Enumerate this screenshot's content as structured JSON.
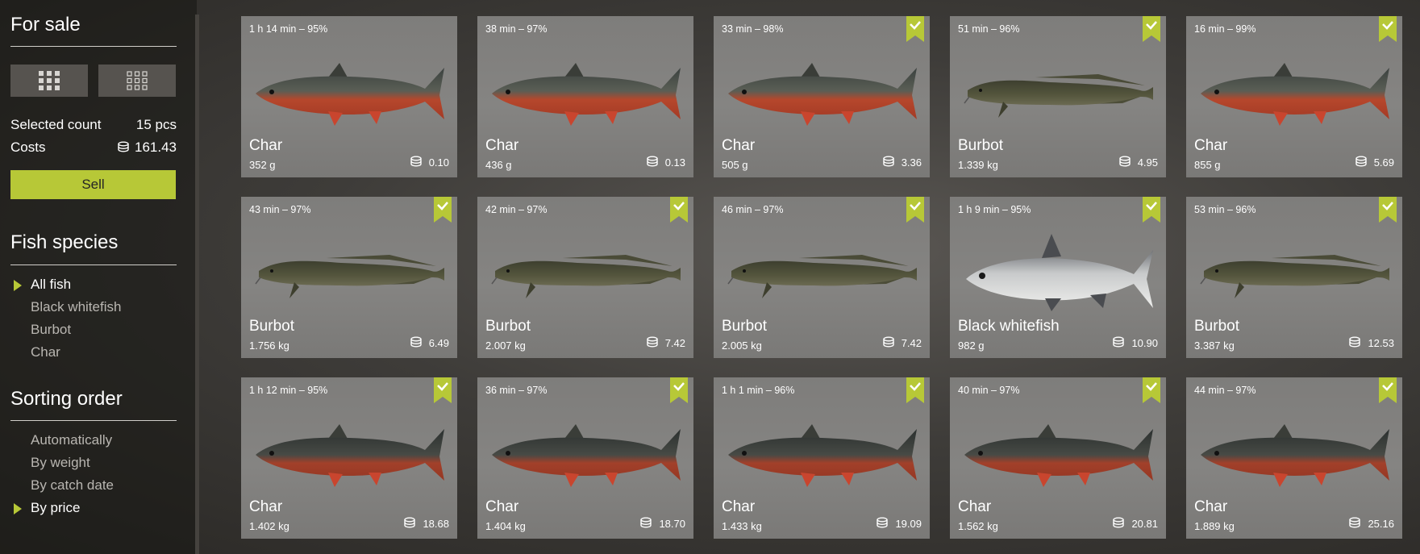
{
  "sidebar": {
    "for_sale_title": "For sale",
    "selected_label": "Selected count",
    "selected_value": "15 pcs",
    "costs_label": "Costs",
    "costs_value": "161.43",
    "sell_label": "Sell",
    "species_title": "Fish species",
    "species": [
      "All fish",
      "Black whitefish",
      "Burbot",
      "Char"
    ],
    "species_active": "All fish",
    "sorting_title": "Sorting order",
    "sorting": [
      "Automatically",
      "By weight",
      "By catch date",
      "By price"
    ],
    "sorting_active": "By price"
  },
  "icons": {
    "view_large": "grid-large-icon",
    "view_small": "grid-small-icon",
    "coin": "coin-stack-icon",
    "selected": "check-bookmark-icon",
    "active_marker": "triangle-right-icon"
  },
  "colors": {
    "accent": "#b7c837",
    "card": "#807f7d"
  },
  "cards": [
    {
      "time": "1 h 14 min – 95%",
      "name": "Char",
      "weight": "352 g",
      "price": "0.10",
      "selected": false,
      "fish": "char-red"
    },
    {
      "time": "38 min – 97%",
      "name": "Char",
      "weight": "436 g",
      "price": "0.13",
      "selected": false,
      "fish": "char-red"
    },
    {
      "time": "33 min – 98%",
      "name": "Char",
      "weight": "505 g",
      "price": "3.36",
      "selected": true,
      "fish": "char-red"
    },
    {
      "time": "51 min – 96%",
      "name": "Burbot",
      "weight": "1.339 kg",
      "price": "4.95",
      "selected": true,
      "fish": "burbot"
    },
    {
      "time": "16 min – 99%",
      "name": "Char",
      "weight": "855 g",
      "price": "5.69",
      "selected": true,
      "fish": "char-red"
    },
    {
      "time": "43 min – 97%",
      "name": "Burbot",
      "weight": "1.756 kg",
      "price": "6.49",
      "selected": true,
      "fish": "burbot"
    },
    {
      "time": "42 min – 97%",
      "name": "Burbot",
      "weight": "2.007 kg",
      "price": "7.42",
      "selected": true,
      "fish": "burbot"
    },
    {
      "time": "46 min – 97%",
      "name": "Burbot",
      "weight": "2.005 kg",
      "price": "7.42",
      "selected": true,
      "fish": "burbot"
    },
    {
      "time": "1 h 9 min – 95%",
      "name": "Black whitefish",
      "weight": "982 g",
      "price": "10.90",
      "selected": true,
      "fish": "whitefish"
    },
    {
      "time": "53 min – 96%",
      "name": "Burbot",
      "weight": "3.387 kg",
      "price": "12.53",
      "selected": true,
      "fish": "burbot"
    },
    {
      "time": "1 h 12 min – 95%",
      "name": "Char",
      "weight": "1.402 kg",
      "price": "18.68",
      "selected": true,
      "fish": "char-dark"
    },
    {
      "time": "36 min – 97%",
      "name": "Char",
      "weight": "1.404 kg",
      "price": "18.70",
      "selected": true,
      "fish": "char-dark"
    },
    {
      "time": "1 h 1 min – 96%",
      "name": "Char",
      "weight": "1.433 kg",
      "price": "19.09",
      "selected": true,
      "fish": "char-dark"
    },
    {
      "time": "40 min – 97%",
      "name": "Char",
      "weight": "1.562 kg",
      "price": "20.81",
      "selected": true,
      "fish": "char-dark"
    },
    {
      "time": "44 min – 97%",
      "name": "Char",
      "weight": "1.889 kg",
      "price": "25.16",
      "selected": true,
      "fish": "char-dark"
    }
  ]
}
